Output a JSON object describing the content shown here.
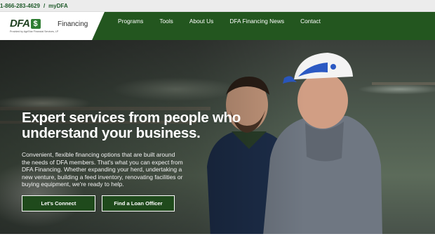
{
  "topbar": {
    "phone": "1-866-283-4629",
    "separator": "/",
    "my_link": "myDFA"
  },
  "header": {
    "logo_text": "DFA",
    "logo_dollar": "$",
    "logo_financing": "Financing",
    "logo_subtext": "Provided by AgriStar Financial Services, LP"
  },
  "nav": {
    "items": [
      "Programs",
      "Tools",
      "About Us",
      "DFA Financing News",
      "Contact"
    ]
  },
  "hero": {
    "headline": "Expert services from people who understand your business.",
    "body": "Convenient, flexible financing options that are built around the needs of DFA members. That's what you can expect from DFA Financing. Whether expanding your herd, undertaking a new venture, building a feed inventory, renovating facilities or buying equipment, we're ready to help.",
    "buttons": {
      "connect": "Let's Connect",
      "loan_officer": "Find a Loan Officer"
    }
  },
  "colors": {
    "brand_green": "#23561f",
    "button_green": "#1f4a1c",
    "topbar_bg": "#ececec"
  }
}
